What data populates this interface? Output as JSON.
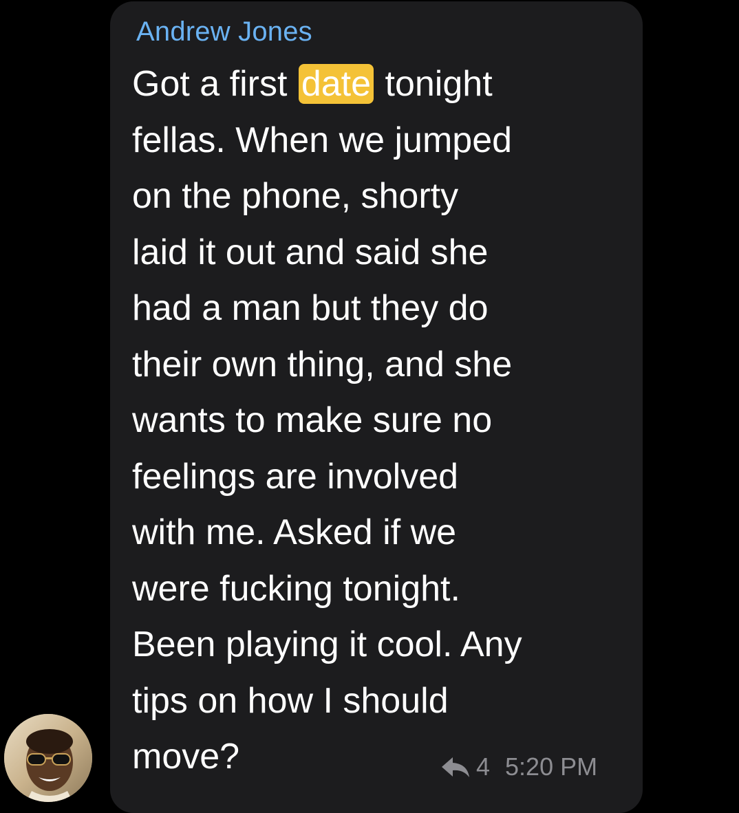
{
  "message": {
    "sender_name": "Andrew Jones",
    "lines": [
      {
        "before": "Got a first ",
        "highlight": "date",
        "after": " tonight"
      },
      {
        "text": "fellas. When we jumped"
      },
      {
        "text": "on the phone, shorty"
      },
      {
        "text": "laid it out and said she"
      },
      {
        "text": "had a man but they do"
      },
      {
        "text": "their own thing, and she"
      },
      {
        "text": "wants to make sure no"
      },
      {
        "text": "feelings are involved"
      },
      {
        "text": "with me. Asked if we"
      },
      {
        "text": "were fucking tonight."
      },
      {
        "text": "Been playing it cool. Any"
      },
      {
        "text": "tips on how I should"
      },
      {
        "text": "move?"
      }
    ],
    "reply_count": "4",
    "time": "5:20 PM"
  },
  "colors": {
    "background": "#000000",
    "bubble": "#1c1c1e",
    "sender_name": "#6ab2f2",
    "message_text": "#ffffff",
    "highlight": "#f4c237",
    "meta_text": "#8d8d92"
  },
  "icons": {
    "reply": "reply-arrow-icon",
    "avatar": "user-avatar-photo"
  }
}
